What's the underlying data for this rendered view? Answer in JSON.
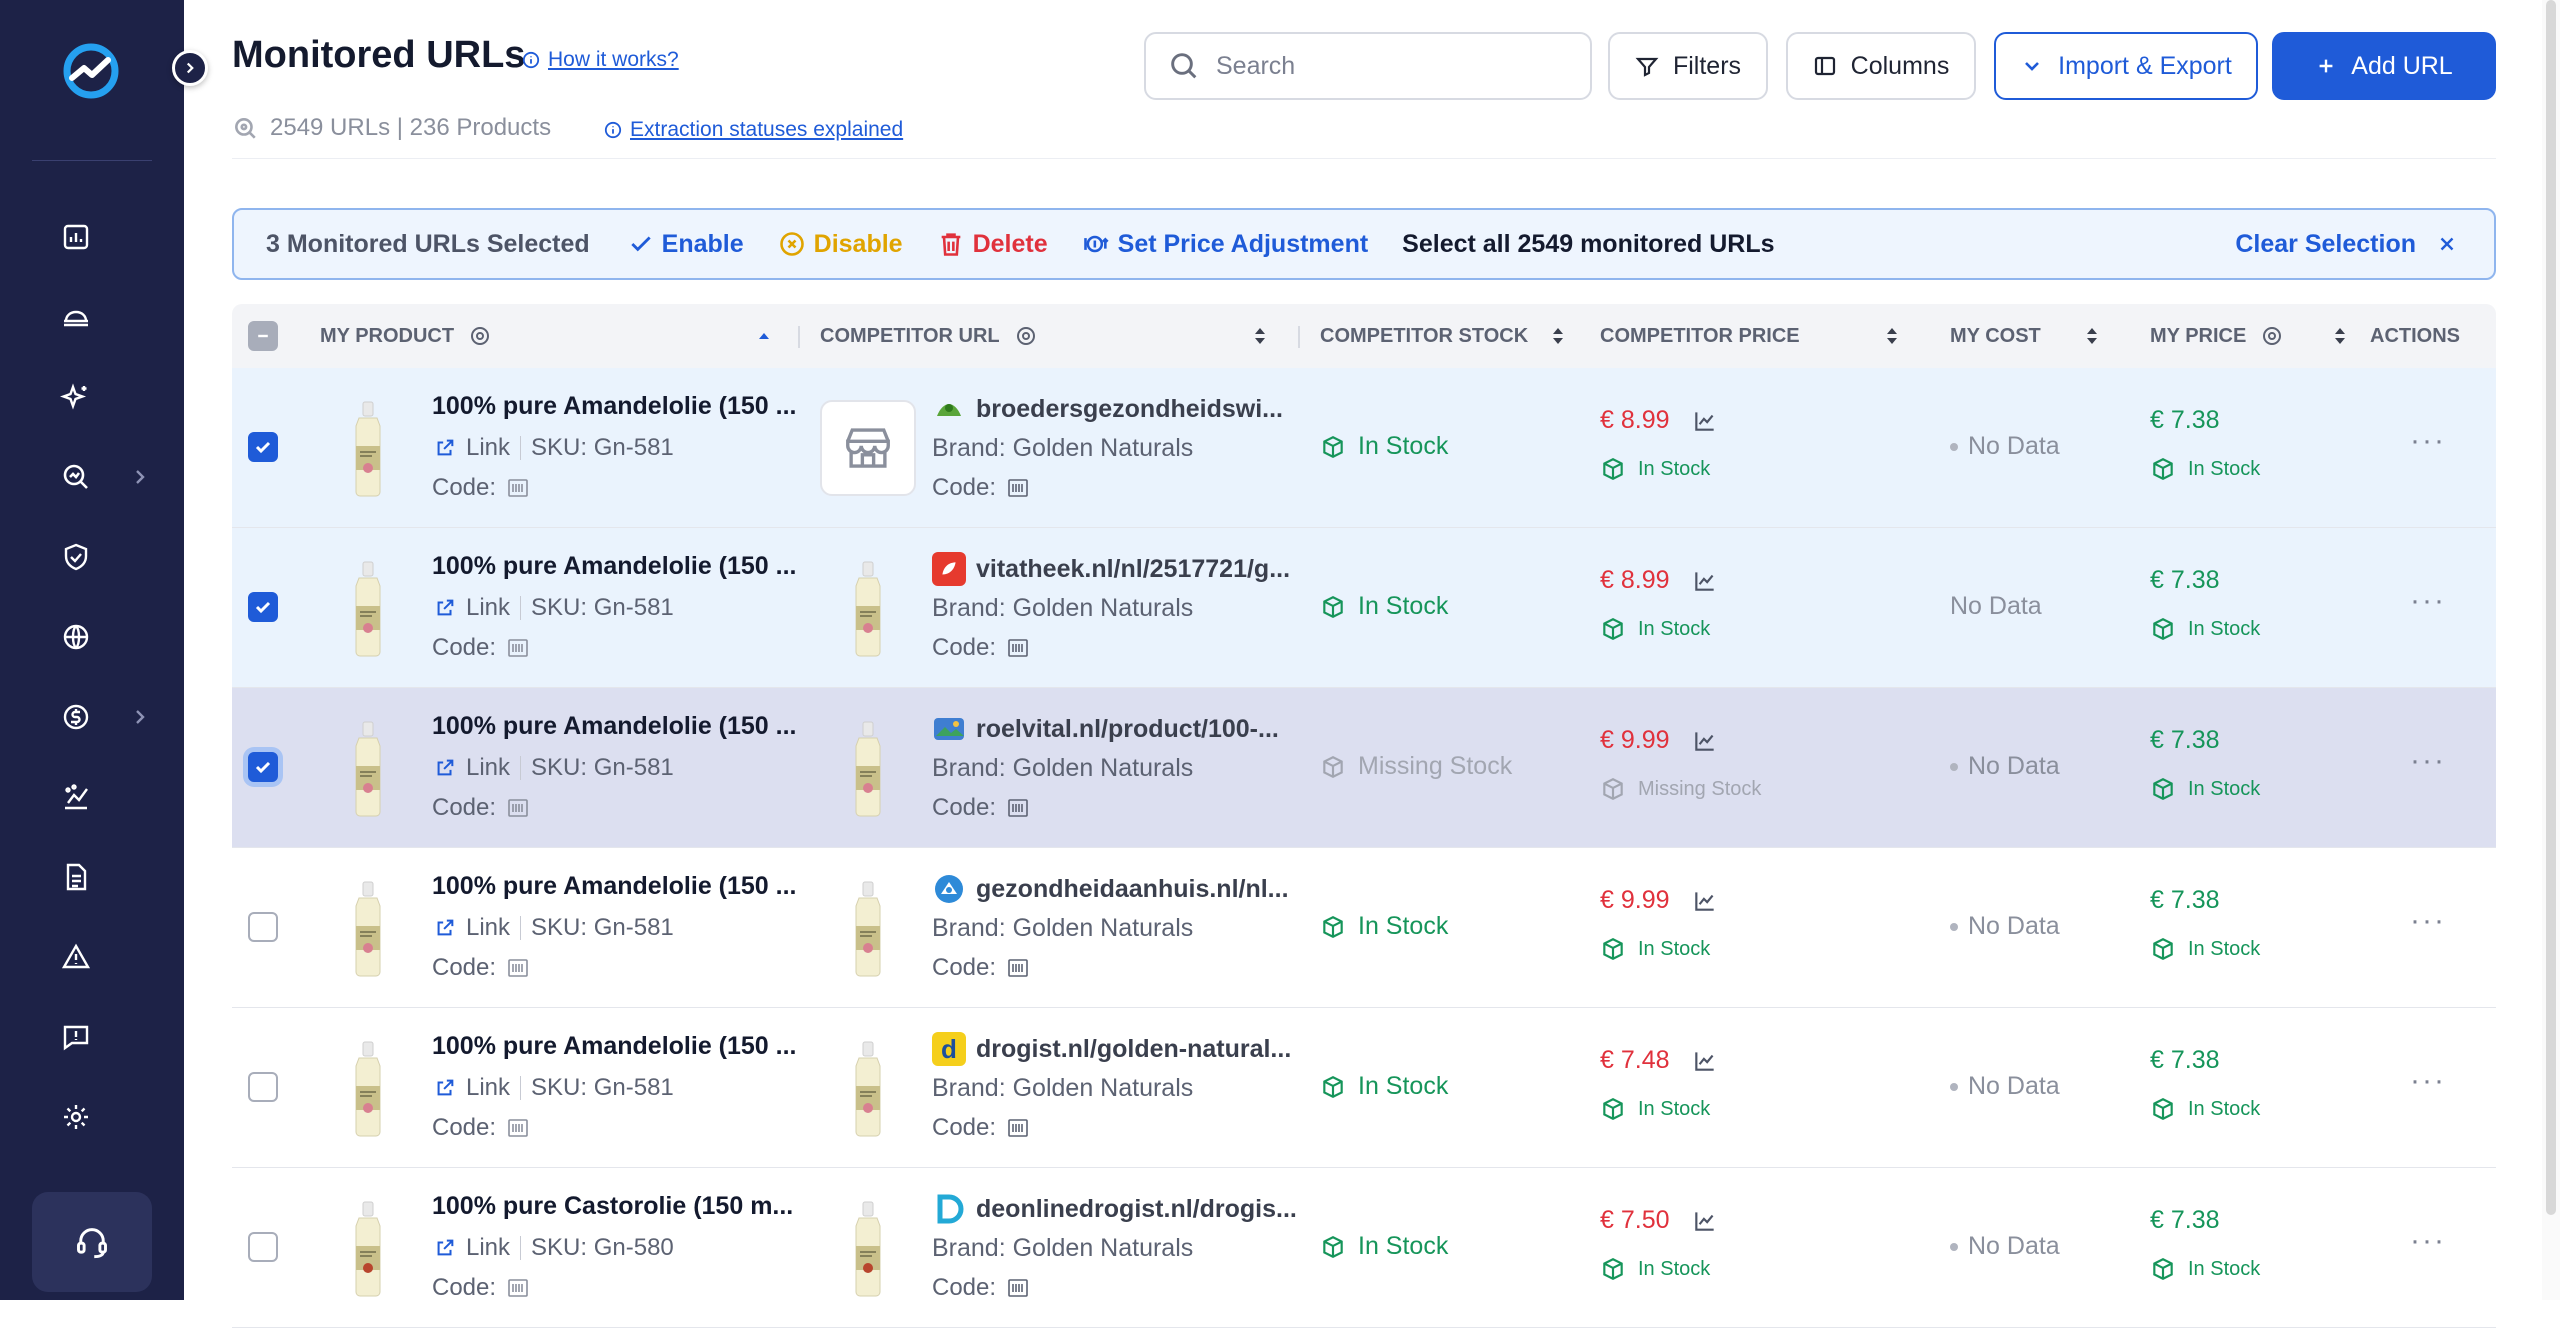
{
  "header": {
    "title": "Monitored URLs",
    "how_link": "How it works?",
    "counts": "2549 URLs | 236 Products",
    "explained_link": "Extraction statuses explained"
  },
  "toolbar": {
    "search_placeholder": "Search",
    "filters": "Filters",
    "columns": "Columns",
    "import_export": "Import & Export",
    "add_url": "Add URL"
  },
  "selection": {
    "count_label": "3 Monitored URLs Selected",
    "enable": "Enable",
    "disable": "Disable",
    "delete": "Delete",
    "price_adjust": "Set Price Adjustment",
    "select_all": "Select all 2549 monitored URLs",
    "clear": "Clear Selection"
  },
  "columns": {
    "my_product": "MY PRODUCT",
    "competitor_url": "COMPETITOR URL",
    "competitor_stock": "COMPETITOR STOCK",
    "competitor_price": "COMPETITOR PRICE",
    "my_cost": "MY COST",
    "my_price": "MY PRICE",
    "actions": "ACTIONS"
  },
  "labels": {
    "link": "Link",
    "code": "Code:",
    "brand": "Brand: Golden Naturals",
    "in_stock": "In Stock",
    "missing_stock": "Missing Stock",
    "no_data": "No Data",
    "more": "···"
  },
  "rows": [
    {
      "product": "100% pure Amandelolie (150 ...",
      "sku": "SKU: Gn-581",
      "url": "broedersgezondheidswi...",
      "comp_stock": "In Stock",
      "comp_price": "€ 8.99",
      "comp_price_stock": "In Stock",
      "my_cost": "No Data",
      "my_price": "€ 7.38",
      "my_price_stock": "In Stock"
    },
    {
      "product": "100% pure Amandelolie (150 ...",
      "sku": "SKU: Gn-581",
      "url": "vitatheek.nl/nl/2517721/g...",
      "comp_stock": "In Stock",
      "comp_price": "€ 8.99",
      "comp_price_stock": "In Stock",
      "my_cost": "No Data",
      "my_price": "€ 7.38",
      "my_price_stock": "In Stock"
    },
    {
      "product": "100% pure Amandelolie (150 ...",
      "sku": "SKU: Gn-581",
      "url": "roelvital.nl/product/100-...",
      "comp_stock": "Missing Stock",
      "comp_price": "€ 9.99",
      "comp_price_stock": "Missing Stock",
      "my_cost": "No Data",
      "my_price": "€ 7.38",
      "my_price_stock": "In Stock"
    },
    {
      "product": "100% pure Amandelolie (150 ...",
      "sku": "SKU: Gn-581",
      "url": "gezondheidaanhuis.nl/nl...",
      "comp_stock": "In Stock",
      "comp_price": "€ 9.99",
      "comp_price_stock": "In Stock",
      "my_cost": "No Data",
      "my_price": "€ 7.38",
      "my_price_stock": "In Stock"
    },
    {
      "product": "100% pure Amandelolie (150 ...",
      "sku": "SKU: Gn-581",
      "url": "drogist.nl/golden-natural...",
      "comp_stock": "In Stock",
      "comp_price": "€ 7.48",
      "comp_price_stock": "In Stock",
      "my_cost": "No Data",
      "my_price": "€ 7.38",
      "my_price_stock": "In Stock"
    },
    {
      "product": "100% pure Castorolie (150 m...",
      "sku": "SKU: Gn-580",
      "url": "deonlinedrogist.nl/drogis...",
      "comp_stock": "In Stock",
      "comp_price": "€ 7.50",
      "comp_price_stock": "In Stock",
      "my_cost": "No Data",
      "my_price": "€ 7.38",
      "my_price_stock": "In Stock"
    }
  ],
  "colors": {
    "sidebar": "#1d2247",
    "accent": "#1f5bd8",
    "in_stock": "#16955a",
    "price": "#e0313c",
    "disable": "#e0a400",
    "delete": "#e0313c"
  }
}
